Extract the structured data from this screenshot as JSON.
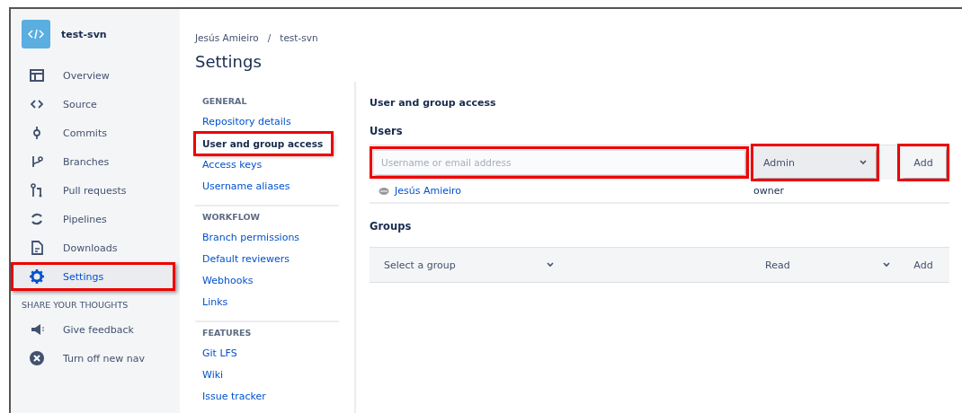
{
  "repo": {
    "name": "test-svn"
  },
  "sidebar": {
    "items": [
      {
        "kind": "overview",
        "label": "Overview",
        "selected": false,
        "highlighted": false
      },
      {
        "kind": "source",
        "label": "Source",
        "selected": false,
        "highlighted": false
      },
      {
        "kind": "commits",
        "label": "Commits",
        "selected": false,
        "highlighted": false
      },
      {
        "kind": "branches",
        "label": "Branches",
        "selected": false,
        "highlighted": false
      },
      {
        "kind": "pulls",
        "label": "Pull requests",
        "selected": false,
        "highlighted": false
      },
      {
        "kind": "pipelines",
        "label": "Pipelines",
        "selected": false,
        "highlighted": false
      },
      {
        "kind": "downloads",
        "label": "Downloads",
        "selected": false,
        "highlighted": false
      },
      {
        "kind": "settings",
        "label": "Settings",
        "selected": true,
        "highlighted": true
      }
    ],
    "section": "SHARE YOUR THOUGHTS",
    "extra_items": [
      {
        "kind": "feedback",
        "label": "Give feedback"
      },
      {
        "kind": "close",
        "label": "Turn off new nav"
      }
    ]
  },
  "breadcrumbs": [
    "Jesús Amieiro",
    "test-svn"
  ],
  "breadcrumb_separator": "/",
  "page_title": "Settings",
  "settings_nav": [
    {
      "heading": "GENERAL",
      "items": [
        {
          "label": "Repository details",
          "selected": false,
          "highlighted": false
        },
        {
          "label": "User and group access",
          "selected": true,
          "highlighted": true
        },
        {
          "label": "Access keys",
          "selected": false,
          "highlighted": false
        },
        {
          "label": "Username aliases",
          "selected": false,
          "highlighted": false
        }
      ]
    },
    {
      "heading": "WORKFLOW",
      "items": [
        {
          "label": "Branch permissions",
          "selected": false,
          "highlighted": false
        },
        {
          "label": "Default reviewers",
          "selected": false,
          "highlighted": false
        },
        {
          "label": "Webhooks",
          "selected": false,
          "highlighted": false
        },
        {
          "label": "Links",
          "selected": false,
          "highlighted": false
        }
      ]
    },
    {
      "heading": "FEATURES",
      "items": [
        {
          "label": "Git LFS",
          "selected": false,
          "highlighted": false
        },
        {
          "label": "Wiki",
          "selected": false,
          "highlighted": false
        },
        {
          "label": "Issue tracker",
          "selected": false,
          "highlighted": false
        }
      ]
    }
  ],
  "main": {
    "heading": "User and group access",
    "users": {
      "heading": "Users",
      "form": {
        "placeholder": "Username or email address",
        "permission": "Admin",
        "button": "Add",
        "input_highlighted": true,
        "select_highlighted": true,
        "button_highlighted": true
      },
      "rows": [
        {
          "name": "Jesús Amieiro",
          "role": "owner"
        }
      ]
    },
    "groups": {
      "heading": "Groups",
      "form": {
        "placeholder": "Select a group",
        "permission": "Read",
        "button": "Add"
      }
    }
  }
}
